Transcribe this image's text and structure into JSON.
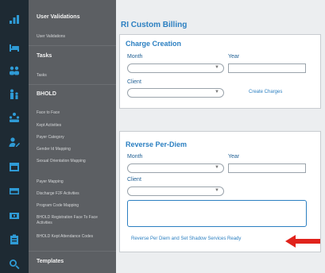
{
  "rail_icons": [
    "chart-icon",
    "bed-icon",
    "group-icon",
    "family-icon",
    "org-chart-icon",
    "user-edit-icon",
    "calendar-icon",
    "card-icon",
    "money-icon",
    "clipboard-icon",
    "search-icon"
  ],
  "menu": {
    "user_validations_header": "User Validations",
    "user_validations_item": "User Validations",
    "tasks_header": "Tasks",
    "tasks_item": "Tasks",
    "bhold_header": "BHOLD",
    "bhold_items": [
      "Face to Face",
      "Kept Activities",
      "Payer Category",
      "Gender Id Mapping",
      "Sexual Orientation Mapping",
      "Payer Mapping",
      "Discharge F2F Activities",
      "Program Code Mapping",
      "BHOLD Registration Face To Face Activities",
      "BHOLD Kept Attendance Codes"
    ],
    "templates_header": "Templates"
  },
  "page": {
    "title": "RI Custom Billing"
  },
  "charge_creation": {
    "title": "Charge Creation",
    "month_label": "Month",
    "year_label": "Year",
    "client_label": "Client",
    "create_link": "Create Charges"
  },
  "reverse_per_diem": {
    "title": "Reverse Per-Diem",
    "month_label": "Month",
    "year_label": "Year",
    "client_label": "Client",
    "action_link": "Reverse Per Diem and Set Shadow Services Ready"
  },
  "colors": {
    "accent": "#2b7fc1",
    "arrow": "#e0231c",
    "sidebar": "#5c5f63",
    "rail": "#1e2a33"
  }
}
